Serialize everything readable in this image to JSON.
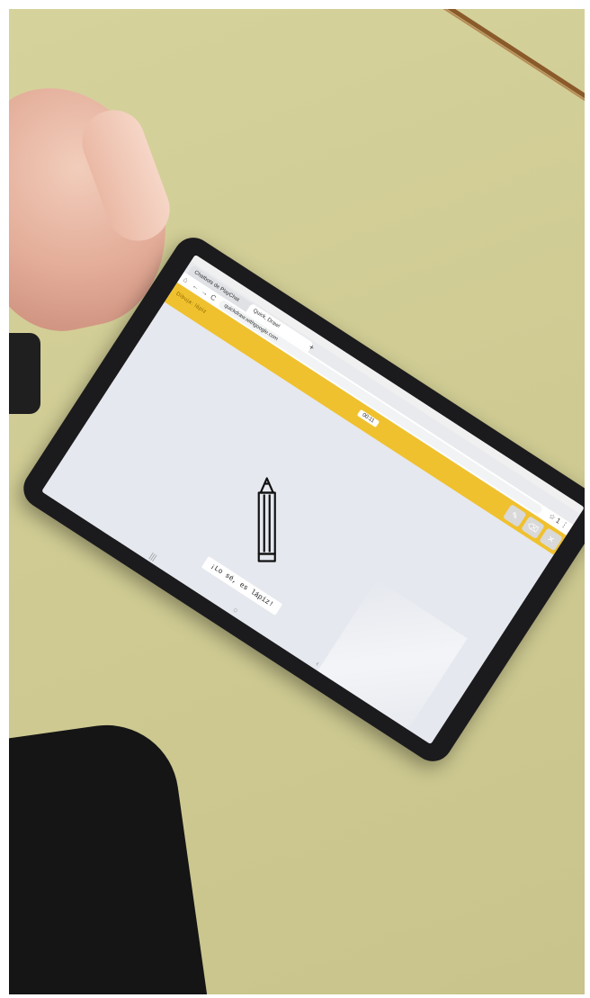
{
  "browser": {
    "tabs": [
      {
        "label": "Chatbots de PlayChat"
      },
      {
        "label": "Quick, Draw!"
      }
    ],
    "new_tab": "+",
    "url": "quickdraw.withgoogle.com",
    "back": "←",
    "forward": "→",
    "reload": "C",
    "home": "⌂",
    "star": "☆",
    "mic": "🎤",
    "tabs_count": "1",
    "menu": "⋮"
  },
  "game": {
    "prompt_label": "Dibuja: lápiz",
    "timer": "00:11",
    "guess_text": "¡Lo sé, es lápiz!",
    "buttons": [
      "✎",
      "⌫",
      "✕"
    ]
  },
  "android_nav": {
    "recent": "|||",
    "home": "○",
    "back": "‹"
  },
  "colors": {
    "accent": "#f0c12e",
    "canvas": "#e5e8ee",
    "bezel": "#1b1b1d",
    "table": "#d6d29c"
  }
}
